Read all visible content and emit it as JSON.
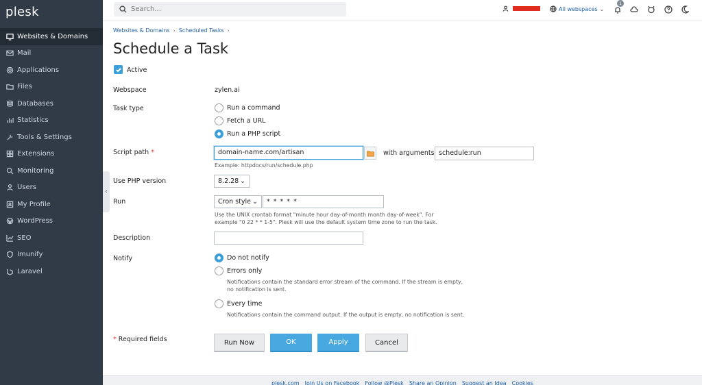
{
  "app": {
    "logo": "plesk"
  },
  "sidebar": {
    "items": [
      {
        "label": "Websites & Domains",
        "icon": "monitor-icon",
        "active": true
      },
      {
        "label": "Mail",
        "icon": "mail-icon"
      },
      {
        "label": "Applications",
        "icon": "gear-icon"
      },
      {
        "label": "Files",
        "icon": "folder-icon"
      },
      {
        "label": "Databases",
        "icon": "database-icon"
      },
      {
        "label": "Statistics",
        "icon": "chart-icon"
      },
      {
        "label": "Tools & Settings",
        "icon": "tools-icon"
      },
      {
        "label": "Extensions",
        "icon": "puzzle-icon"
      },
      {
        "label": "Monitoring",
        "icon": "monitoring-icon"
      },
      {
        "label": "Users",
        "icon": "user-icon"
      },
      {
        "label": "My Profile",
        "icon": "profile-icon"
      },
      {
        "label": "WordPress",
        "icon": "wordpress-icon"
      },
      {
        "label": "SEO",
        "icon": "seo-icon"
      },
      {
        "label": "Imunify",
        "icon": "shield-icon"
      },
      {
        "label": "Laravel",
        "icon": "laravel-icon"
      }
    ]
  },
  "topbar": {
    "search_placeholder": "Search...",
    "webspaces": "All webspaces",
    "notifications": "1"
  },
  "breadcrumb": [
    "Websites & Domains",
    "Scheduled Tasks"
  ],
  "page": {
    "title": "Schedule a Task",
    "active_label": "Active"
  },
  "form": {
    "webspace_label": "Webspace",
    "webspace_value": "zylen.ai",
    "task_type_label": "Task type",
    "task_types": [
      "Run a command",
      "Fetch a URL",
      "Run a PHP script"
    ],
    "script_path_label": "Script path",
    "required_mark": "*",
    "script_path_value": "domain-name.com/artisan",
    "args_label": "with arguments",
    "args_value": "schedule:run",
    "script_hint": "Example: httpdocs/run/schedule.php",
    "php_label": "Use PHP version",
    "php_value": "8.2.28",
    "run_label": "Run",
    "run_mode": "Cron style",
    "cron_value": "* * * * *",
    "run_hint_1": "Use the UNIX crontab format \"minute hour day-of-month month day-of-week\". For",
    "run_hint_2": "example \"0 22 * * 1-5\". Plesk will use the default system time zone to run the task.",
    "description_label": "Description",
    "notify_label": "Notify",
    "notify_options": [
      "Do not notify",
      "Errors only",
      "Every time"
    ],
    "errors_hint_1": "Notifications contain the standard error stream of the command. If the stream is empty,",
    "errors_hint_2": "no notification is sent.",
    "every_hint": "Notifications contain the command output. If the output is empty, no notification is sent.",
    "required_fields": "Required fields"
  },
  "buttons": {
    "run_now": "Run Now",
    "ok": "OK",
    "apply": "Apply",
    "cancel": "Cancel"
  },
  "footer": [
    "plesk.com",
    "Join Us on Facebook",
    "Follow @Plesk",
    "Share an Opinion",
    "Suggest an Idea",
    "Cookies"
  ]
}
